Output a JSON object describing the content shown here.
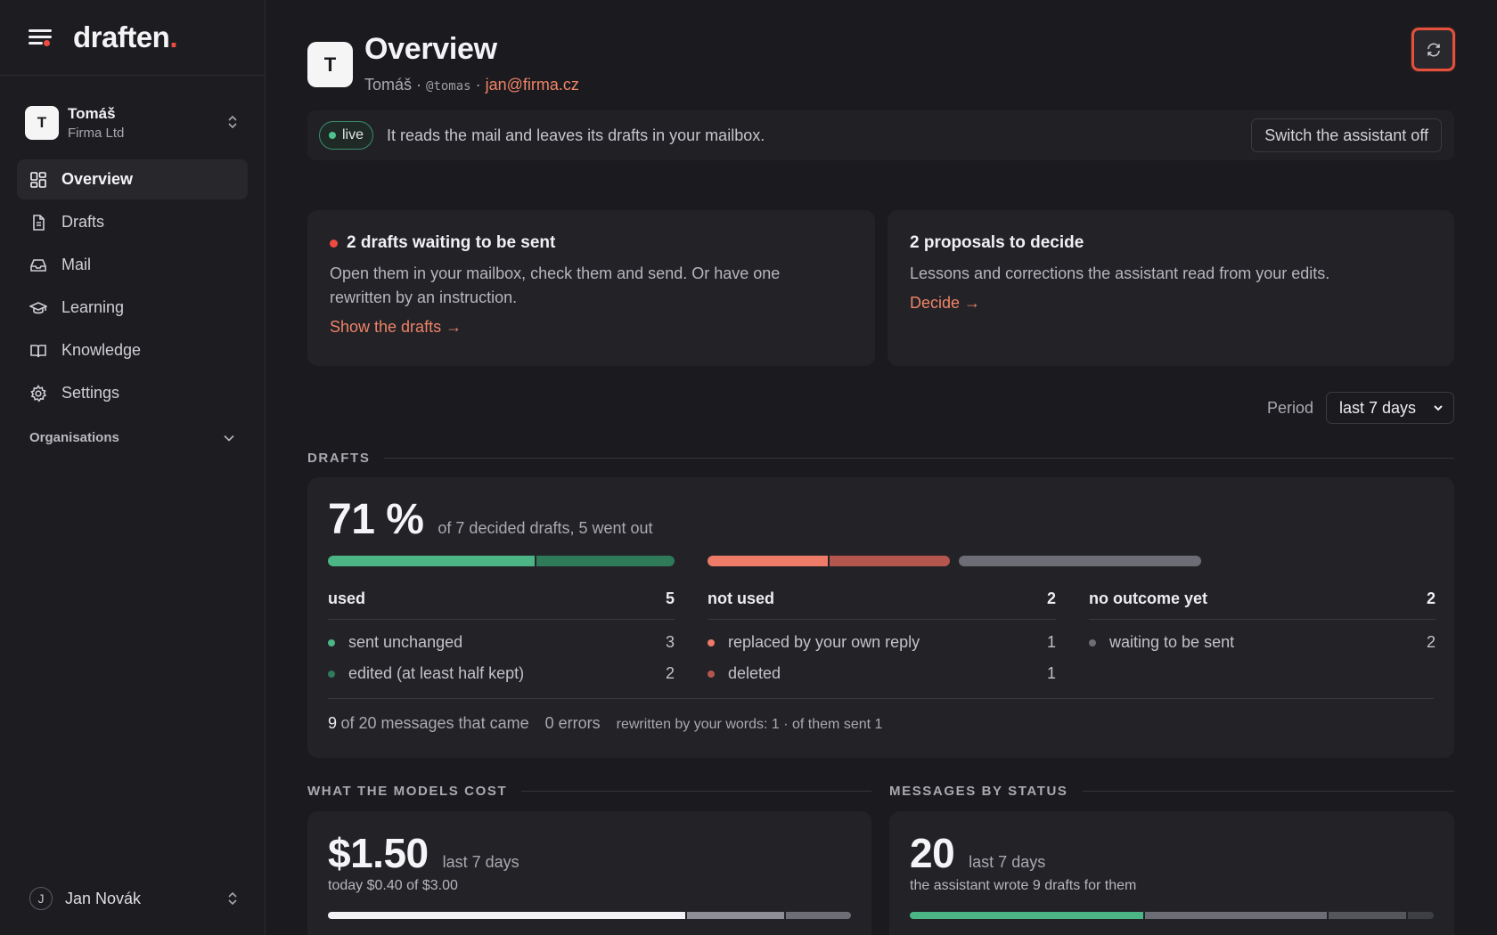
{
  "brand": {
    "name": "draften",
    "dot": "."
  },
  "account": {
    "initial": "T",
    "name": "Tomáš",
    "org": "Firma Ltd"
  },
  "nav": [
    {
      "label": "Overview",
      "icon": "grid-icon",
      "active": true
    },
    {
      "label": "Drafts",
      "icon": "document-icon",
      "active": false
    },
    {
      "label": "Mail",
      "icon": "inbox-icon",
      "active": false
    },
    {
      "label": "Learning",
      "icon": "graduation-cap-icon",
      "active": false
    },
    {
      "label": "Knowledge",
      "icon": "book-icon",
      "active": false
    },
    {
      "label": "Settings",
      "icon": "gear-icon",
      "active": false
    }
  ],
  "organisations_label": "Organisations",
  "user": {
    "initial": "J",
    "name": "Jan Novák"
  },
  "header": {
    "initial": "T",
    "title": "Overview",
    "name": "Tomáš",
    "sep": " · ",
    "handle": "@tomas",
    "email": "jan@firma.cz"
  },
  "status": {
    "pill": "live",
    "text": "It reads the mail and leaves its drafts in your mailbox.",
    "switch_label": "Switch the assistant off"
  },
  "cards": {
    "drafts_waiting": {
      "title": "2 drafts waiting to be sent",
      "text": "Open them in your mailbox, check them and send. Or have one rewritten by an instruction.",
      "link": "Show the drafts →"
    },
    "proposals": {
      "title": "2 proposals to decide",
      "text": "Lessons and corrections the assistant read from your edits.",
      "link": "Decide →"
    }
  },
  "period": {
    "label": "Period",
    "value": "last 7 days"
  },
  "drafts": {
    "section": "DRAFTS",
    "percent": "71 %",
    "percent_note": "of 7 decided drafts, 5 went out",
    "bars": {
      "used": [
        {
          "value": 3,
          "color": "#4cb585"
        },
        {
          "value": 2,
          "color": "#2f7a58"
        }
      ],
      "not_used": [
        {
          "value": 1,
          "color": "#ee7a68"
        },
        {
          "value": 1,
          "color": "#b4564e"
        }
      ],
      "no_outcome": [
        {
          "value": 2,
          "color": "#6d6d75"
        }
      ]
    },
    "columns": [
      {
        "title": "used",
        "count": "5",
        "items": [
          {
            "label": "sent unchanged",
            "count": "3",
            "color": "#4cb585"
          },
          {
            "label": "edited (at least half kept)",
            "count": "2",
            "color": "#2f7a58"
          }
        ]
      },
      {
        "title": "not used",
        "count": "2",
        "items": [
          {
            "label": "replaced by your own reply",
            "count": "1",
            "color": "#ee7a68"
          },
          {
            "label": "deleted",
            "count": "1",
            "color": "#b4564e"
          }
        ]
      },
      {
        "title": "no outcome yet",
        "count": "2",
        "items": [
          {
            "label": "waiting to be sent",
            "count": "2",
            "color": "#6d6d75"
          }
        ]
      }
    ],
    "footer": {
      "num": "9",
      "messages": "of 20 messages that came",
      "errors": "0 errors",
      "rewritten": "rewritten by your words: 1 · of them sent 1"
    }
  },
  "cost": {
    "section": "WHAT THE MODELS COST",
    "amount": "$1.50",
    "period": "last 7 days",
    "today": "today $0.40 of $3.00",
    "bar": [
      {
        "value": 1.1,
        "color": "#f2f2f4"
      },
      {
        "value": 0.3,
        "color": "#8e8e96"
      },
      {
        "value": 0.2,
        "color": "#6d6d75"
      }
    ]
  },
  "messages": {
    "section": "MESSAGES BY STATUS",
    "count": "20",
    "period": "last 7 days",
    "note": "the assistant wrote 9 drafts for them",
    "bar": [
      {
        "value": 9,
        "color": "#4cb585"
      },
      {
        "value": 7,
        "color": "#6d6d75"
      },
      {
        "value": 3,
        "color": "#55555c"
      },
      {
        "value": 1,
        "color": "#3e3e45"
      }
    ]
  }
}
